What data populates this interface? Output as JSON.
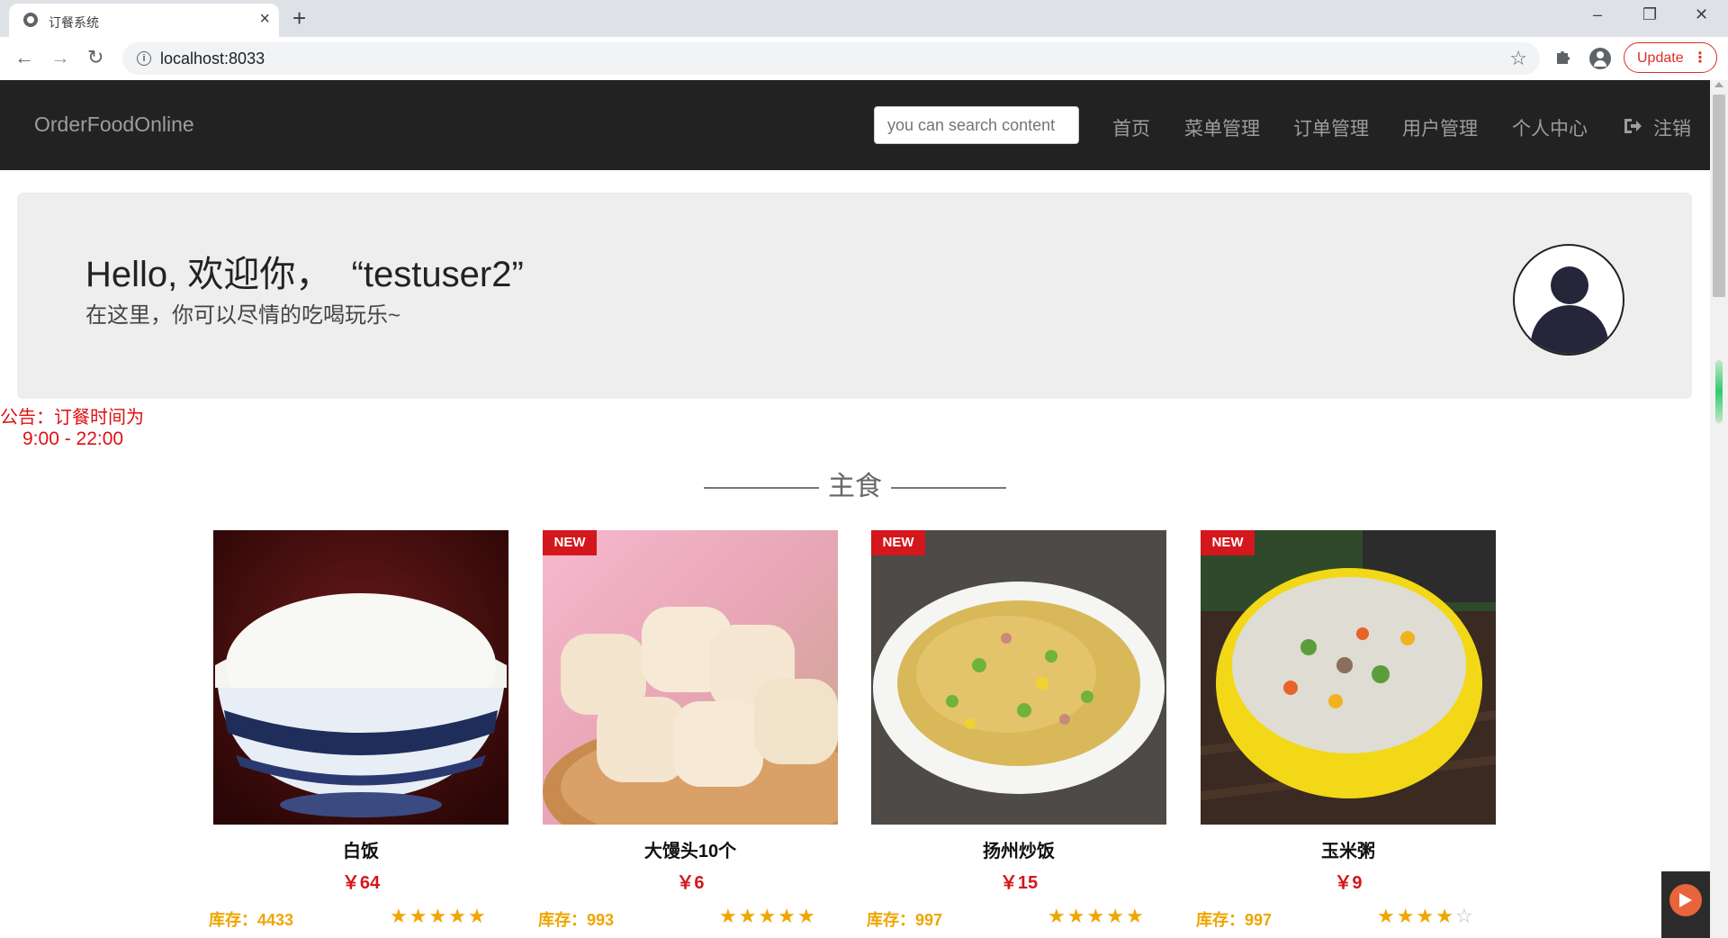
{
  "browser": {
    "tab_title": "订餐系统",
    "tab_close": "×",
    "new_tab": "+",
    "url": "localhost:8033",
    "update_label": "Update",
    "update_menu": "⋮",
    "window_controls": {
      "minimize": "–",
      "restore": "❐",
      "close": "✕"
    },
    "nav": {
      "back": "←",
      "forward": "→",
      "reload": "↻",
      "info": "i"
    },
    "bookmark_star": "☆",
    "extensions_icon": "puzzle-icon"
  },
  "navbar": {
    "brand": "OrderFoodOnline",
    "search_placeholder": "you can search content",
    "items": [
      {
        "label": "首页"
      },
      {
        "label": "菜单管理"
      },
      {
        "label": "订单管理"
      },
      {
        "label": "用户管理"
      },
      {
        "label": "个人中心"
      },
      {
        "label": "注销"
      }
    ]
  },
  "jumbotron": {
    "greeting": "Hello, 欢迎你，  “testuser2”",
    "subtitle": "在这里，你可以尽情的吃喝玩乐~"
  },
  "notice": {
    "line1": "公告：订餐时间为",
    "line2": "9:00 - 22:00"
  },
  "section": {
    "title": "主食"
  },
  "products": [
    {
      "name": "白饭",
      "price": "￥64",
      "stock": "库存：4433",
      "rating": 5,
      "new": false
    },
    {
      "name": "大馒头10个",
      "price": "￥6",
      "stock": "库存：993",
      "rating": 5,
      "new": true
    },
    {
      "name": "扬州炒饭",
      "price": "￥15",
      "stock": "库存：997",
      "rating": 5,
      "new": true
    },
    {
      "name": "玉米粥",
      "price": "￥9",
      "stock": "库存：997",
      "rating": 4,
      "new": true
    }
  ],
  "badge_label": "NEW"
}
